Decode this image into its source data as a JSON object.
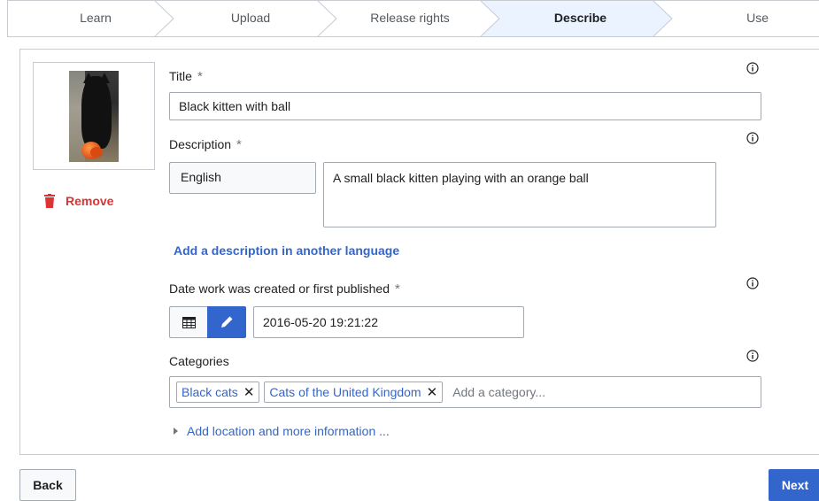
{
  "steps": [
    {
      "label": "Learn"
    },
    {
      "label": "Upload"
    },
    {
      "label": "Release rights"
    },
    {
      "label": "Describe"
    },
    {
      "label": "Use"
    }
  ],
  "current_step": "Describe",
  "colors": {
    "accent": "#3366cc",
    "destructive": "#dd3333",
    "current_step_bg": "#eaf3ff",
    "border": "#c8ccd1"
  },
  "thumbnail": {
    "icon": "image-thumbnail"
  },
  "remove": {
    "label": "Remove",
    "icon": "trash-icon"
  },
  "title_field": {
    "label": "Title",
    "value": "Black kitten with ball"
  },
  "description_field": {
    "label": "Description",
    "language": "English",
    "value": "A small black kitten playing with an orange ball"
  },
  "add_language_link": "Add a description in another language",
  "date_field": {
    "label": "Date work was created or first published",
    "value": "2016-05-20 19:21:22"
  },
  "categories_field": {
    "label": "Categories",
    "chips": [
      {
        "label": "Black cats"
      },
      {
        "label": "Cats of the United Kingdom"
      }
    ],
    "placeholder": "Add a category..."
  },
  "more_info_link": "Add location and more information ...",
  "required_marker": "*",
  "chip_remove_glyph": "✕",
  "buttons": {
    "back": "Back",
    "next": "Next"
  }
}
